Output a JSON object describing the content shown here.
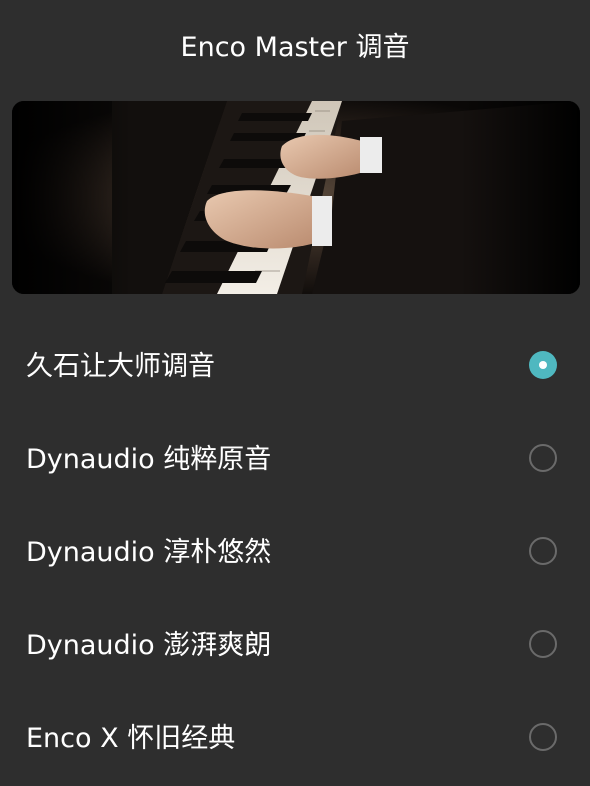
{
  "header": {
    "title": "Enco Master 调音"
  },
  "banner": {
    "icon": "piano-hands-photo"
  },
  "colors": {
    "accent": "#4fb8c0",
    "background": "#2e2e2e"
  },
  "options": [
    {
      "label": "久石让大师调音",
      "selected": true
    },
    {
      "label": "Dynaudio 纯粹原音",
      "selected": false
    },
    {
      "label": "Dynaudio 淳朴悠然",
      "selected": false
    },
    {
      "label": "Dynaudio 澎湃爽朗",
      "selected": false
    },
    {
      "label": "Enco X 怀旧经典",
      "selected": false
    }
  ]
}
